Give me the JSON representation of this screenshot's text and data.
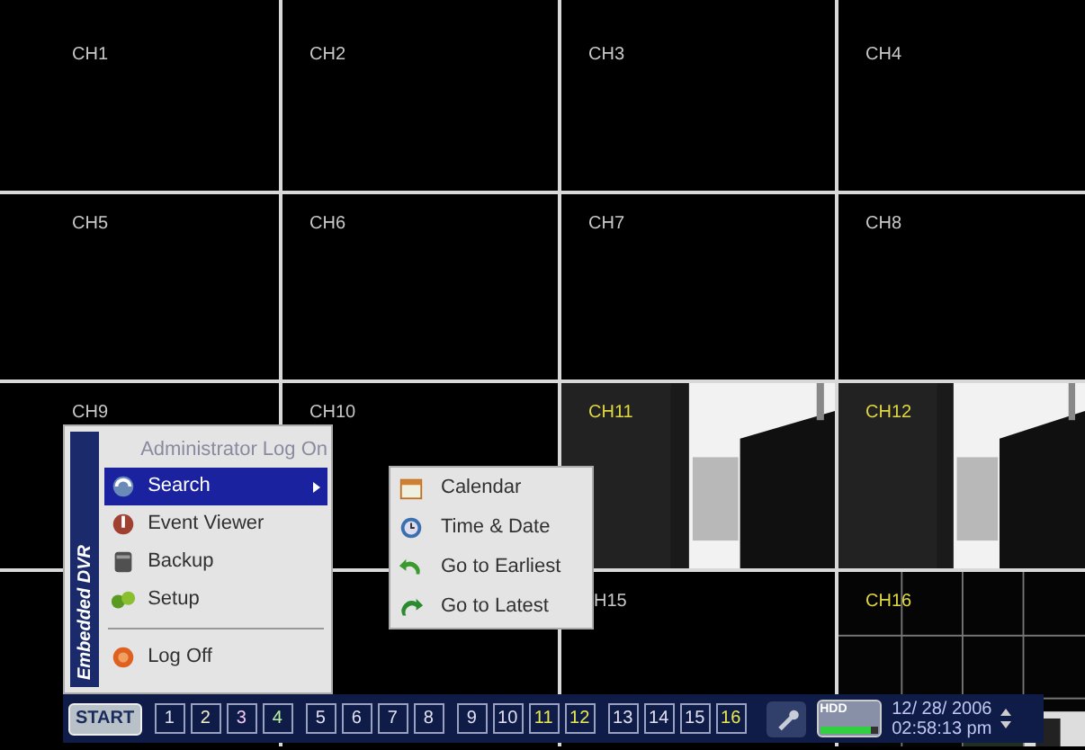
{
  "channels": [
    {
      "label": "CH1",
      "live": false
    },
    {
      "label": "CH2",
      "live": false
    },
    {
      "label": "CH3",
      "live": false
    },
    {
      "label": "CH4",
      "live": false
    },
    {
      "label": "CH5",
      "live": false
    },
    {
      "label": "CH6",
      "live": false
    },
    {
      "label": "CH7",
      "live": false
    },
    {
      "label": "CH8",
      "live": false
    },
    {
      "label": "CH9",
      "live": false
    },
    {
      "label": "CH10",
      "live": false
    },
    {
      "label": "CH11",
      "live": true
    },
    {
      "label": "CH12",
      "live": true
    },
    {
      "live": false
    },
    {
      "live": false
    },
    {
      "label": "H15",
      "live": false
    },
    {
      "label": "CH16",
      "live": true
    }
  ],
  "menu": {
    "side_label": "Embedded DVR",
    "header": "Administrator Log On",
    "items": [
      {
        "label": "Search",
        "kind": "search",
        "selected": true,
        "submenu": true
      },
      {
        "label": "Event Viewer",
        "kind": "event",
        "selected": false,
        "submenu": false
      },
      {
        "label": "Backup",
        "kind": "backup",
        "selected": false,
        "submenu": false
      },
      {
        "label": "Setup",
        "kind": "setup",
        "selected": false,
        "submenu": false
      },
      {
        "label": "Log Off",
        "kind": "logoff",
        "selected": false,
        "submenu": false
      }
    ]
  },
  "submenu": {
    "items": [
      {
        "label": "Calendar",
        "kind": "calendar"
      },
      {
        "label": "Time & Date",
        "kind": "clock"
      },
      {
        "label": "Go to Earliest",
        "kind": "back"
      },
      {
        "label": "Go to Latest",
        "kind": "forward"
      }
    ]
  },
  "taskbar": {
    "start": "START",
    "channel_buttons": [
      {
        "label": "1",
        "color": "#e0e0f0"
      },
      {
        "label": "2",
        "color": "#f0f0c8"
      },
      {
        "label": "3",
        "color": "#f0c8f0"
      },
      {
        "label": "4",
        "color": "#b8f0a0"
      },
      {
        "label": "5",
        "color": "#e0e0f0"
      },
      {
        "label": "6",
        "color": "#e0e0f0"
      },
      {
        "label": "7",
        "color": "#e0e0f0"
      },
      {
        "label": "8",
        "color": "#e0e0f0"
      },
      {
        "label": "9",
        "color": "#e0e0f0"
      },
      {
        "label": "10",
        "color": "#e0e0f0"
      },
      {
        "label": "11",
        "color": "#e8e850"
      },
      {
        "label": "12",
        "color": "#e8e850"
      },
      {
        "label": "13",
        "color": "#e0e0f0"
      },
      {
        "label": "14",
        "color": "#e0e0f0"
      },
      {
        "label": "15",
        "color": "#e0e0f0"
      },
      {
        "label": "16",
        "color": "#e8e850"
      }
    ],
    "hdd": {
      "label": "HDD",
      "level": 0.9
    },
    "date": "12/ 28/ 2006",
    "time": "02:58:13 pm"
  }
}
